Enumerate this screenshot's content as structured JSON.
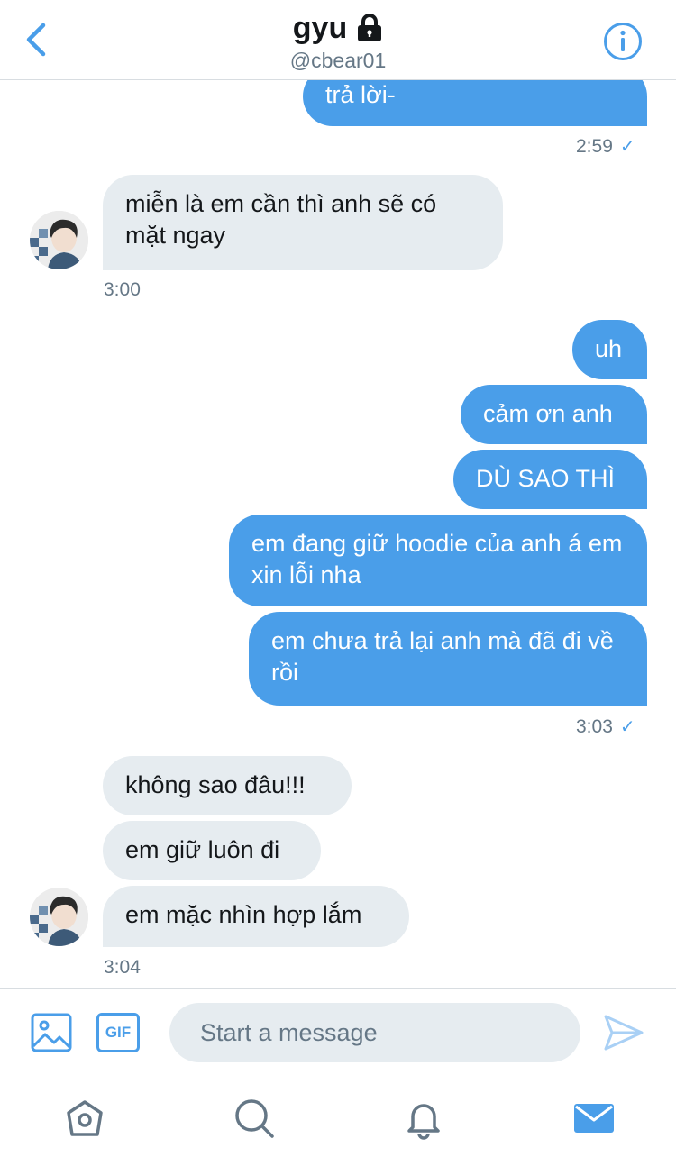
{
  "header": {
    "title": "gyu",
    "handle": "@cbear01"
  },
  "messages": {
    "m1": "trả lời-",
    "t1": "2:59",
    "m2": "miễn là em cần thì anh sẽ có mặt ngay",
    "t2": "3:00",
    "m3": "uh",
    "m4": "cảm ơn anh",
    "m5": "DÙ SAO THÌ",
    "m6": "em đang giữ hoodie của anh á em xin lỗi nha",
    "m7": "em chưa trả lại anh mà đã đi về rồi",
    "t3": "3:03",
    "m8": "không sao đâu!!!",
    "m9": "em giữ luôn đi",
    "m10": "em mặc nhìn hợp lắm",
    "t4": "3:04",
    "check": "✓"
  },
  "composer": {
    "gif_label": "GIF",
    "placeholder": "Start a message"
  },
  "icons": {
    "back": "chevron-left-icon",
    "lock": "lock-icon",
    "info": "info-icon",
    "image": "image-icon",
    "send": "send-icon",
    "home": "home-icon",
    "search": "search-icon",
    "notifications": "bell-icon",
    "messages": "mail-icon"
  },
  "colors": {
    "accent": "#4a9ee9",
    "received_bubble": "#e6ecf0",
    "muted_text": "#657786"
  }
}
